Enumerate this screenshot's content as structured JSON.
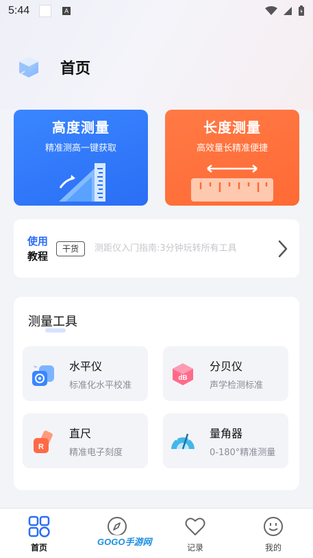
{
  "status_bar": {
    "time": "5:44",
    "a_badge": "A"
  },
  "header": {
    "title": "首页",
    "logo_icon": "cube-logo-icon"
  },
  "cards": [
    {
      "title": "高度测量",
      "subtitle": "精准测高一键获取",
      "color": "#2a6ef5",
      "icon": "height-ruler-icon"
    },
    {
      "title": "长度测量",
      "subtitle": "高效量长精准便捷",
      "color": "#ff6a35",
      "icon": "length-ruler-icon"
    }
  ],
  "guide": {
    "label_line1": "使用",
    "label_line2": "教程",
    "tag": "干货",
    "text": "测距仪入门指南:3分钟玩转所有工具"
  },
  "tools": {
    "title": "测量工具",
    "items": [
      {
        "name": "水平仪",
        "desc": "标准化水平校准",
        "icon": "level-icon"
      },
      {
        "name": "分贝仪",
        "desc": "声学检测标准",
        "icon": "decibel-icon"
      },
      {
        "name": "直尺",
        "desc": "精准电子刻度",
        "icon": "ruler-icon"
      },
      {
        "name": "量角器",
        "desc": "0-180°精准测量",
        "icon": "protractor-icon"
      }
    ]
  },
  "nav": [
    {
      "label": "首页",
      "icon": "home-grid-icon",
      "active": true
    },
    {
      "label": "",
      "icon": "compass-icon",
      "active": false
    },
    {
      "label": "记录",
      "icon": "heart-icon",
      "active": false
    },
    {
      "label": "我的",
      "icon": "smile-face-icon",
      "active": false
    }
  ],
  "watermark": "GOGO手游网",
  "colors": {
    "accent_blue": "#2a6ef5",
    "accent_orange": "#ff6a35",
    "background": "#f3f4f8"
  }
}
